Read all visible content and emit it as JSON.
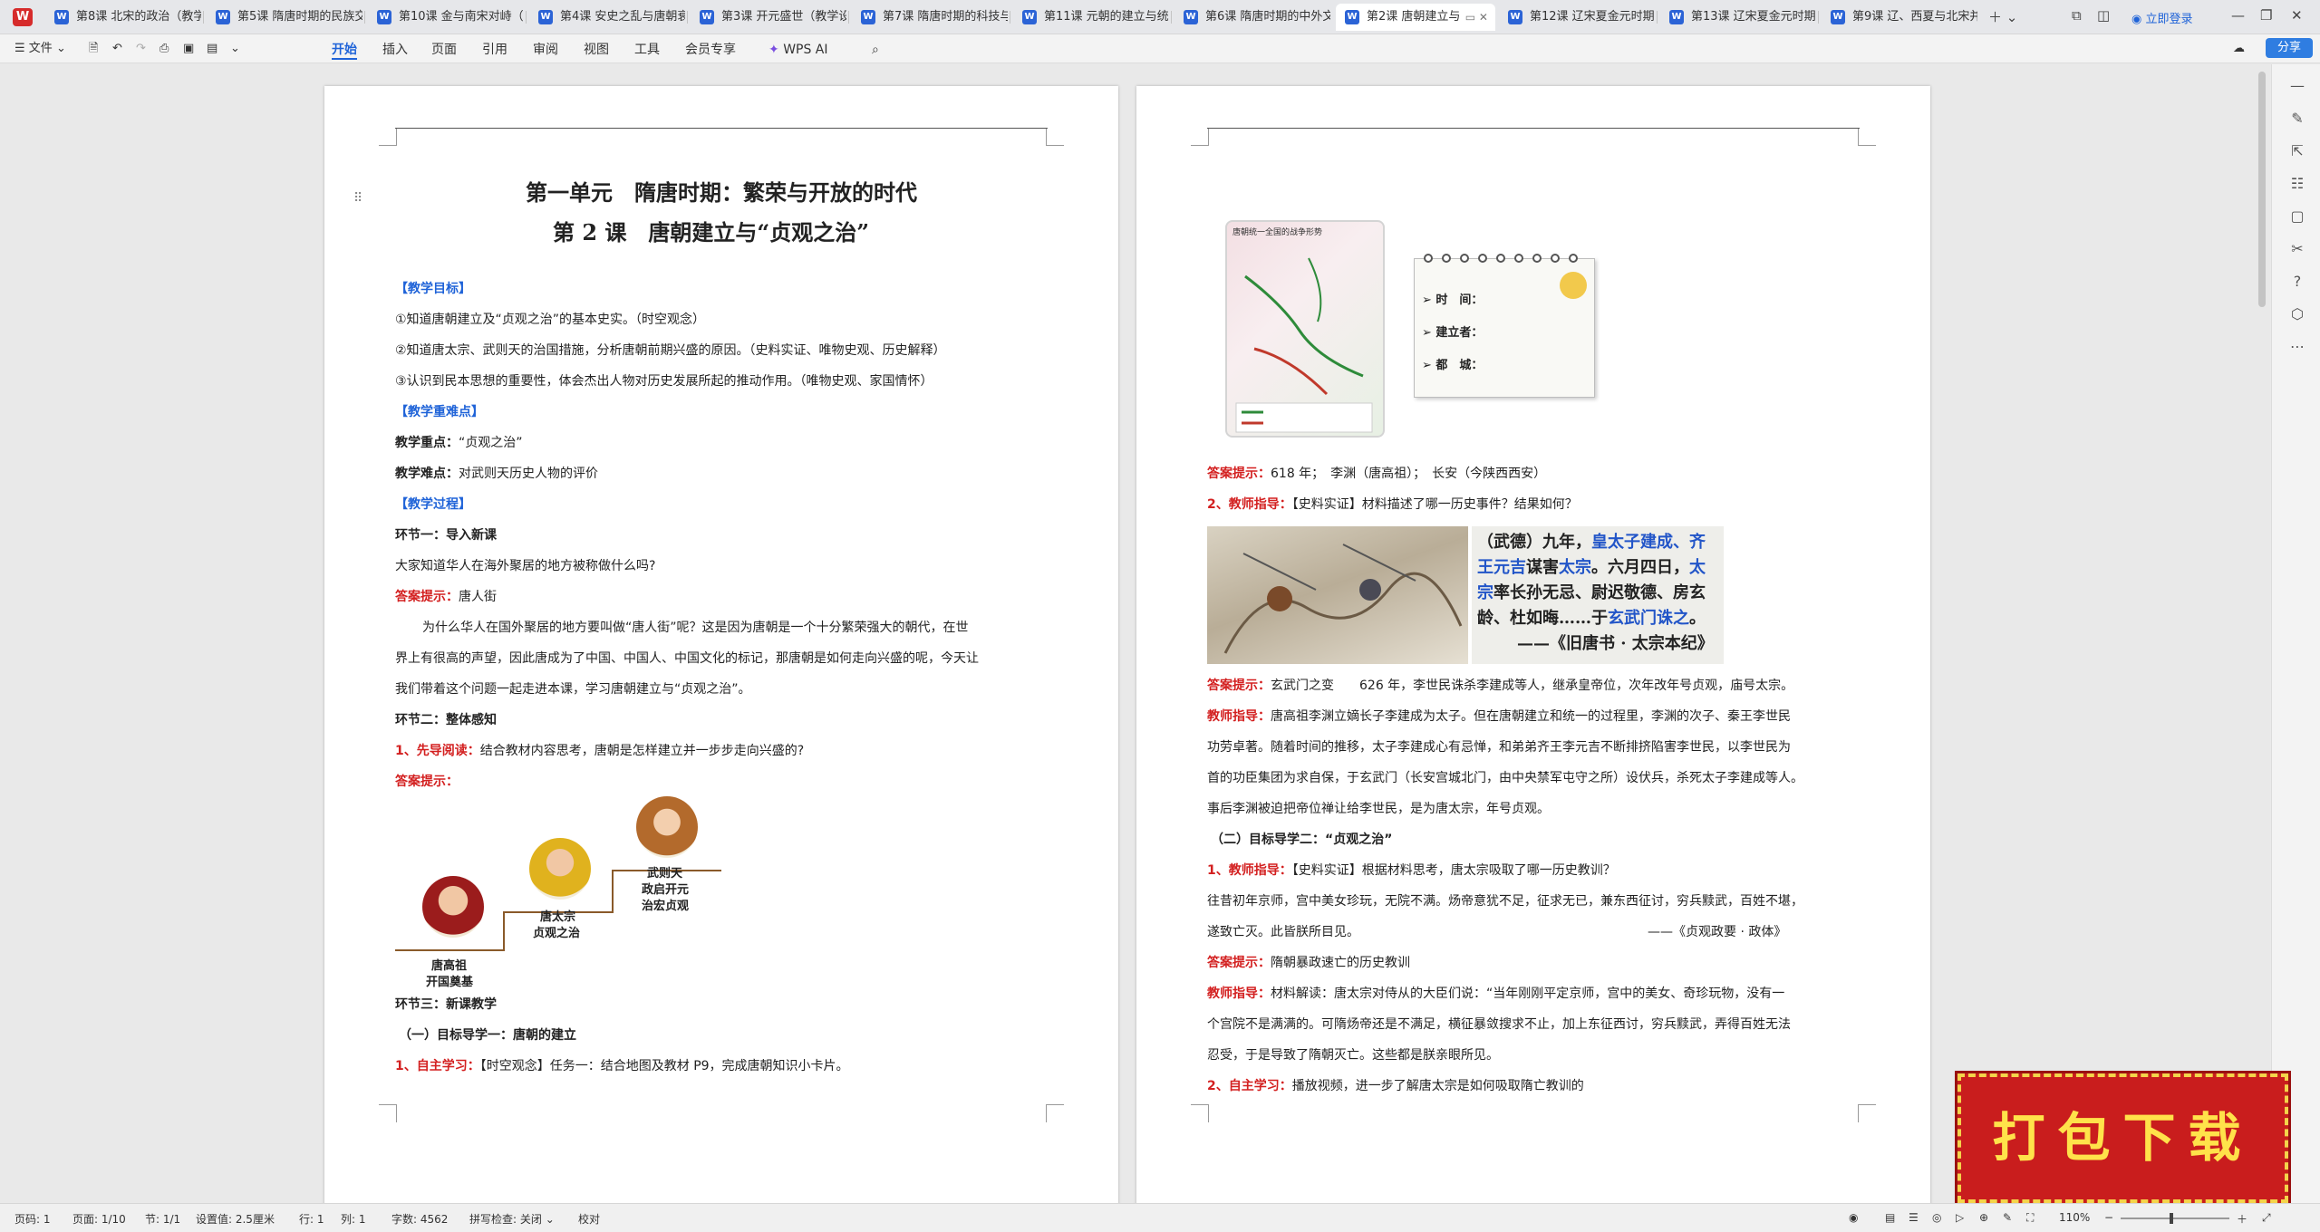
{
  "tabs": [
    {
      "label": "第8课 北宋的政治（教学",
      "active": false
    },
    {
      "label": "第5课 隋唐时期的民族交",
      "active": false
    },
    {
      "label": "第10课 金与南宋对峙（",
      "active": false
    },
    {
      "label": "第4课 安史之乱与唐朝衰",
      "active": false
    },
    {
      "label": "第3课 开元盛世（教学设",
      "active": false
    },
    {
      "label": "第7课 隋唐时期的科技与",
      "active": false
    },
    {
      "label": "第11课 元朝的建立与统一",
      "active": false
    },
    {
      "label": "第6课 隋唐时期的中外文",
      "active": false
    },
    {
      "label": "第2课 唐朝建立与",
      "active": true
    },
    {
      "label": "第12课 辽宋夏金元时期",
      "active": false
    },
    {
      "label": "第13课 辽宋夏金元时期",
      "active": false
    },
    {
      "label": "第9课 辽、西夏与北宋并",
      "active": false
    }
  ],
  "login_label": "立即登录",
  "toolbar": {
    "file_label": "文件",
    "menus": [
      "开始",
      "插入",
      "页面",
      "引用",
      "审阅",
      "视图",
      "工具",
      "会员专享"
    ],
    "ai_label": "WPS AI",
    "share_label": "分享"
  },
  "left_page": {
    "unit_title": "第一单元　隋唐时期：繁荣与开放的时代",
    "lesson_title": "第 2 课　唐朝建立与“贞观之治”",
    "goals_head": "【教学目标】",
    "goal1": "①知道唐朝建立及“贞观之治”的基本史实。（时空观念）",
    "goal2": "②知道唐太宗、武则天的治国措施，分析唐朝前期兴盛的原因。（史料实证、唯物史观、历史解释）",
    "goal3": "③认识到民本思想的重要性，体会杰出人物对历史发展所起的推动作用。（唯物史观、家国情怀）",
    "key_head": "【教学重难点】",
    "key_label": "教学重点：",
    "key_text": "“贞观之治”",
    "diff_label": "教学难点：",
    "diff_text": "对武则天历史人物的评价",
    "process_head": "【教学过程】",
    "step1": "环节一：导入新课",
    "q1": "大家知道华人在海外聚居的地方被称做什么吗?",
    "ans_label": "答案提示：",
    "ans1": "唐人街",
    "para1": "为什么华人在国外聚居的地方要叫做“唐人街”呢？这是因为唐朝是一个十分繁荣强大的朝代，在世",
    "para2": "界上有很高的声望，因此唐成为了中国、中国人、中国文化的标记，那唐朝是如何走向兴盛的呢，今天让",
    "para3": "我们带着这个问题一起走进本课，学习唐朝建立与“贞观之治”。",
    "step2": "环节二：整体感知",
    "pre_read_label": "1、先导阅读：",
    "pre_read_text": "结合教材内容思考，唐朝是怎样建立并一步步走向兴盛的?",
    "ans_label2": "答案提示：",
    "emperor1_name": "唐高祖",
    "emperor1_desc": "开国奠基",
    "emperor2_name": "唐太宗",
    "emperor2_desc": "贞观之治",
    "emperor3_name": "武则天",
    "emperor3_desc1": "政启开元",
    "emperor3_desc2": "治宏贞观",
    "step3": "环节三：新课教学",
    "sub1": "（一）目标导学一：唐朝的建立",
    "self_label": "1、自主学习：",
    "self_text": "【时空观念】任务一：结合地图及教材 P9，完成唐朝知识小卡片。"
  },
  "right_page": {
    "map_title": "唐朝统一全国的战争形势",
    "card_time": "时　间：",
    "card_founder": "建立者：",
    "card_capital": "都　城：",
    "ans1_label": "答案提示：",
    "ans1_text": "618 年；　李渊（唐高祖）；　长安（今陕西西安）",
    "guide2_label": "2、教师指导：",
    "guide2_text": "【史料实证】材料描述了哪一历史事件？结果如何？",
    "quote_l1a": "（武德）九年，",
    "quote_l1b": "皇太子建成、齐",
    "quote_l2a": "王元吉",
    "quote_l2b": "谋害",
    "quote_l2c": "太宗",
    "quote_l2d": "。六月四日，",
    "quote_l2e": "太",
    "quote_l3a": "宗",
    "quote_l3b": "率长孙无忌、尉迟敬德、房玄",
    "quote_l4a": "龄、杜如晦……于",
    "quote_l4b": "玄武门诛之",
    "quote_l4c": "。",
    "quote_src": "——《旧唐书 · 太宗本纪》",
    "ans2_label": "答案提示：",
    "ans2_text": "玄武门之变　　626 年，李世民诛杀李建成等人，继承皇帝位，次年改年号贞观，庙号太宗。",
    "tg_label": "教师指导：",
    "tg_l1": "唐高祖李渊立嫡长子李建成为太子。但在唐朝建立和统一的过程里，李渊的次子、秦王李世民",
    "tg_l2": "功劳卓著。随着时间的推移，太子李建成心有忌惮，和弟弟齐王李元吉不断排挤陷害李世民，以李世民为",
    "tg_l3": "首的功臣集团为求自保，于玄武门（长安宫城北门，由中央禁军屯守之所）设伏兵，杀死太子李建成等人。",
    "tg_l4": "事后李渊被迫把帝位禅让给李世民，是为唐太宗，年号贞观。",
    "sub2": "（二）目标导学二：“贞观之治”",
    "g1_label": "1、教师指导：",
    "g1_text": "【史料实证】根据材料思考，唐太宗吸取了哪一历史教训？",
    "m1": "往昔初年京师，宫中美女珍玩，无院不满。炀帝意犹不足，征求无已，兼东西征讨，穷兵黩武，百姓不堪，",
    "m2": "遂致亡灭。此皆朕所目见。",
    "m2_src": "——《贞观政要 · 政体》",
    "ans3_label": "答案提示：",
    "ans3_text": "隋朝暴政速亡的历史教训",
    "tg2_label": "教师指导：",
    "tg2_l1": "材料解读：唐太宗对侍从的大臣们说：“当年刚刚平定京师，宫中的美女、奇珍玩物，没有一",
    "tg2_l2": "个宫院不是满满的。可隋炀帝还是不满足，横征暴敛搜求不止，加上东征西讨，穷兵黩武，弄得百姓无法",
    "tg2_l3": "忍受，于是导致了隋朝灭亡。这些都是朕亲眼所见。",
    "self2_label": "2、自主学习：",
    "self2_text": "播放视频，进一步了解唐太宗是如何吸取隋亡教训的"
  },
  "status": {
    "page_no": "页码: 1",
    "pages": "页面: 1/10",
    "section": "节: 1/1",
    "setting": "设置值: 2.5厘米",
    "row": "行: 1",
    "col": "列: 1",
    "words": "字数: 4562",
    "spell": "拼写检查: 关闭",
    "proof": "校对",
    "zoom": "110%"
  },
  "download_sticker": "打包下载",
  "colors": {
    "accent_blue": "#1f63d8",
    "accent_red": "#d32020",
    "sticker_red": "#c91d1d",
    "sticker_text": "#ffe24a"
  }
}
